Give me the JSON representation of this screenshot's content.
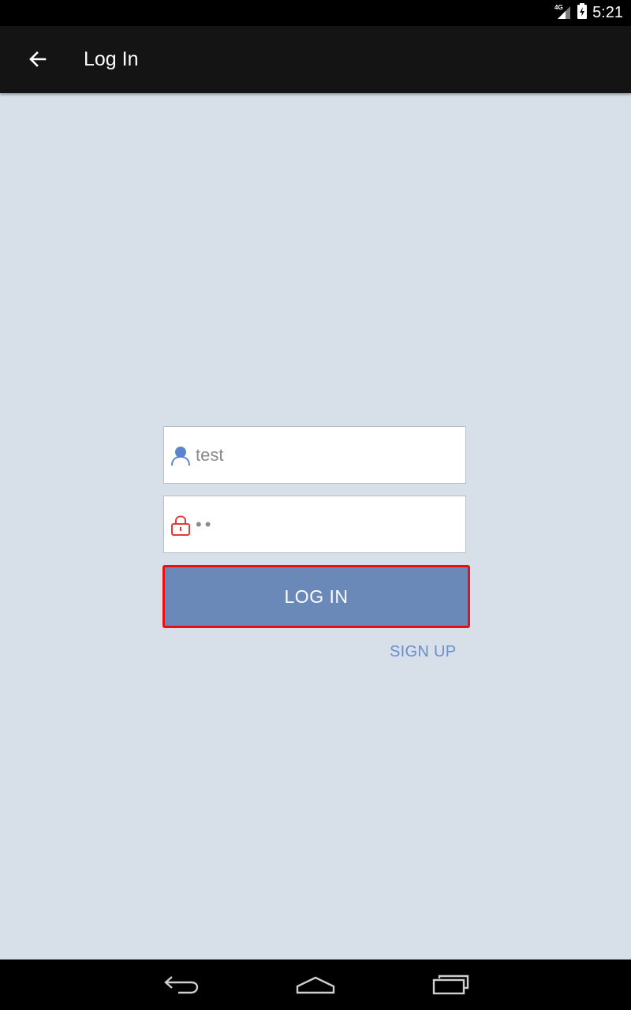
{
  "status_bar": {
    "network_label": "4G",
    "time": "5:21"
  },
  "app_bar": {
    "title": "Log In",
    "back_icon": "arrow-left-icon"
  },
  "login_form": {
    "username": {
      "icon": "user-icon",
      "value": "test"
    },
    "password": {
      "icon": "lock-icon",
      "value": "••"
    },
    "login_button_label": "LOG IN",
    "signup_link_label": "SIGN UP"
  },
  "colors": {
    "background": "#d7dfe8",
    "app_bar": "#141414",
    "button": "#6b89b8",
    "button_highlight_border": "#ee0e0e",
    "link": "#6c8dcf",
    "user_icon": "#5b84cf",
    "lock_icon": "#e53935"
  },
  "nav_bar": {
    "back": "nav-back-icon",
    "home": "nav-home-icon",
    "recents": "nav-recents-icon"
  }
}
